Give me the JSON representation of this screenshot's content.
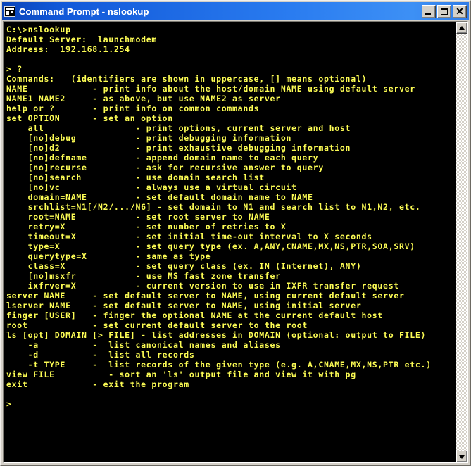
{
  "window": {
    "title": "Command Prompt - nslookup",
    "system_icon": "console-icon",
    "buttons": {
      "minimize": "–",
      "maximize": "□",
      "close": "✕"
    }
  },
  "colors": {
    "titlebar_start": "#0a44b8",
    "titlebar_end": "#3d90f5",
    "console_bg": "#000000",
    "console_fg": "#fcfc54",
    "window_face": "#d4d0c8"
  },
  "scrollbar": {
    "up_arrow": "scroll-up-icon",
    "down_arrow": "scroll-down-icon",
    "position": "bottom"
  },
  "console": {
    "lines": [
      "C:\\>nslookup",
      "Default Server:  launchmodem",
      "Address:  192.168.1.254",
      "",
      "> ?",
      "Commands:   (identifiers are shown in uppercase, [] means optional)",
      "NAME            - print info about the host/domain NAME using default server",
      "NAME1 NAME2     - as above, but use NAME2 as server",
      "help or ?       - print info on common commands",
      "set OPTION      - set an option",
      "    all                 - print options, current server and host",
      "    [no]debug           - print debugging information",
      "    [no]d2              - print exhaustive debugging information",
      "    [no]defname         - append domain name to each query",
      "    [no]recurse         - ask for recursive answer to query",
      "    [no]search          - use domain search list",
      "    [no]vc              - always use a virtual circuit",
      "    domain=NAME         - set default domain name to NAME",
      "    srchlist=N1[/N2/.../N6] - set domain to N1 and search list to N1,N2, etc.",
      "    root=NAME           - set root server to NAME",
      "    retry=X             - set number of retries to X",
      "    timeout=X           - set initial time-out interval to X seconds",
      "    type=X              - set query type (ex. A,ANY,CNAME,MX,NS,PTR,SOA,SRV)",
      "    querytype=X         - same as type",
      "    class=X             - set query class (ex. IN (Internet), ANY)",
      "    [no]msxfr           - use MS fast zone transfer",
      "    ixfrver=X           - current version to use in IXFR transfer request",
      "server NAME     - set default server to NAME, using current default server",
      "lserver NAME    - set default server to NAME, using initial server",
      "finger [USER]   - finger the optional NAME at the current default host",
      "root            - set current default server to the root",
      "ls [opt] DOMAIN [> FILE] - list addresses in DOMAIN (optional: output to FILE)",
      "    -a          -  list canonical names and aliases",
      "    -d          -  list all records",
      "    -t TYPE     -  list records of the given type (e.g. A,CNAME,MX,NS,PTR etc.)",
      "view FILE          - sort an 'ls' output file and view it with pg",
      "exit            - exit the program",
      "",
      ">"
    ]
  }
}
